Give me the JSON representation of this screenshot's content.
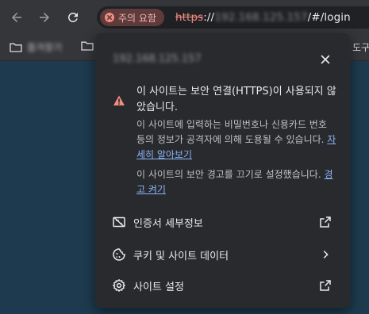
{
  "toolbar": {
    "back_icon": "arrow-left-icon",
    "forward_icon": "arrow-right-icon",
    "reload_icon": "reload-icon",
    "security_chip": {
      "label": "주의 요함",
      "icon": "warning-circle-icon"
    },
    "url": {
      "protocol": "https",
      "separator": "://",
      "host": "192.168.125.157",
      "path": "/#/login"
    }
  },
  "bookmarks": [
    {
      "label": "즐겨찾기",
      "icon": "folder-icon"
    },
    {
      "label": "",
      "icon": "folder-icon"
    },
    {
      "label": "도구",
      "icon": ""
    }
  ],
  "popup": {
    "site": "192.168.125.157",
    "close_icon": "close-icon",
    "warning_icon": "warning-triangle-icon",
    "title": "이 사이트는 보안 연결(HTTPS)이 사용되지 않았습니다.",
    "body": "이 사이트에 입력하는 비밀번호나 신용카드 번호 등의 정보가 공격자에 의해 도용될 수 있습니다.",
    "learn_more": "자세히 알아보기",
    "warn_text": "이 사이트의 보안 경고를 끄기로 설정했습니다.",
    "warn_link": "경고 켜기",
    "rows": [
      {
        "label": "인증서 세부정보",
        "icon": "certificate-icon",
        "trail": "open-external-icon"
      },
      {
        "label": "쿠키 및 사이트 데이터",
        "icon": "cookie-icon",
        "trail": "chevron-right-icon"
      },
      {
        "label": "사이트 설정",
        "icon": "settings-gear-icon",
        "trail": "open-external-icon"
      }
    ]
  },
  "colors": {
    "toolbar_bg": "#35363a",
    "popup_bg": "#292a2d",
    "danger": "#f28b82",
    "link": "#8ab4f8",
    "page_bg": "#1d3a4e"
  }
}
